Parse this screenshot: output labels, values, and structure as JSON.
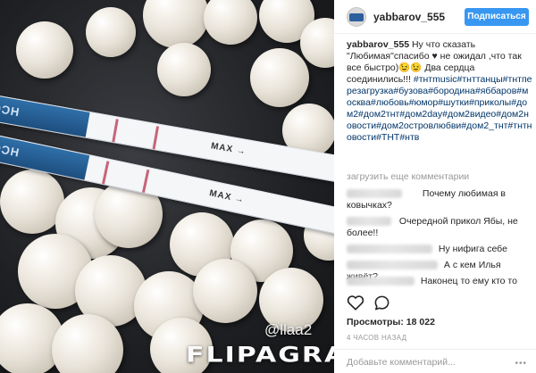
{
  "post": {
    "username": "yabbarov_555",
    "follow_label": "Подписаться",
    "caption": {
      "user": "yabbarov_555",
      "text": "Ну что сказать \"Любимая\"спасибо ♥ не ожидал ,что так все быстро)😉😉 Два сердца соединились!!!",
      "hashtags": "#тнтmusic#тнттанцы#тнтперезагрузка#бузова#бородина#яббаров#москва#любовь#юмор#шутки#приколы#дом2#дом2тнт#дом2day#дом2видео#дом2новости#дом2островлюбви#дом2_тнт#тнтновости#ТНТ#нтв"
    },
    "load_more_label": "загрузить еще комментарии",
    "comments": [
      {
        "text": "Почему любимая в ковычках?"
      },
      {
        "text": "Очередной прикол Ябы, не более!!"
      },
      {
        "text": "Ну нифига себе"
      },
      {
        "text": "А с кем Илья живёт?"
      },
      {
        "text": "Наконец то ему кто то"
      }
    ],
    "views_label": "Просмотры: 18 022",
    "time_label": "4 ЧАСОВ НАЗАД",
    "add_comment_placeholder": "Добавьте комментарий...",
    "more_label": "•••"
  },
  "photo": {
    "test_label": "HCG",
    "max_label": "MAX →",
    "watermark_user": "@llaa2",
    "watermark_brand": "FLIPAGRAM"
  },
  "icons": {
    "like": "heart-icon",
    "comment": "comment-bubble-icon",
    "more": "more-options-icon"
  },
  "colors": {
    "follow_button": "#3897f0",
    "hashtag": "#003569",
    "muted": "#999999"
  }
}
